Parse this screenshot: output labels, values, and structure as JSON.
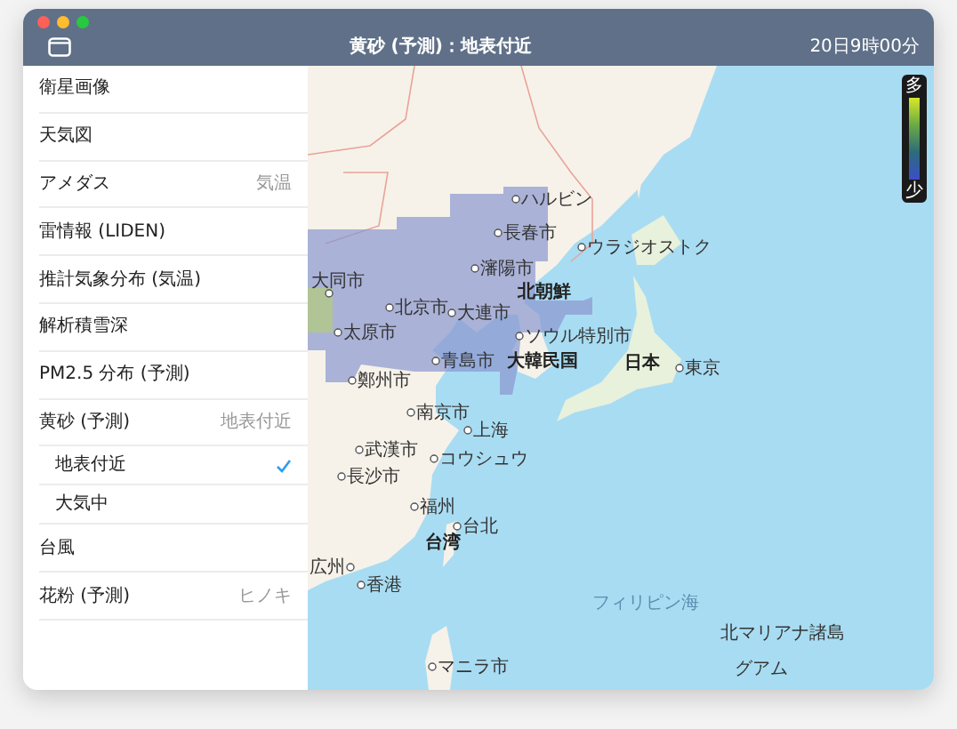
{
  "window": {
    "title": "黄砂 (予測)：地表付近",
    "time": "20日9時00分"
  },
  "sidebar": {
    "items": [
      {
        "label": "衛星画像"
      },
      {
        "label": "天気図"
      },
      {
        "label": "アメダス",
        "value": "気温"
      },
      {
        "label": "雷情報 (LIDEN)"
      },
      {
        "label": "推計気象分布 (気温)"
      },
      {
        "label": "解析積雪深"
      },
      {
        "label": "PM2.5 分布 (予測)"
      },
      {
        "label": "黄砂 (予測)",
        "value": "地表付近",
        "children": [
          {
            "label": "地表付近",
            "selected": true
          },
          {
            "label": "大気中",
            "selected": false
          }
        ]
      },
      {
        "label": "台風"
      },
      {
        "label": "花粉 (予測)",
        "value": "ヒノキ"
      }
    ]
  },
  "map": {
    "labels": [
      {
        "text": "ハルビン",
        "kind": "city"
      },
      {
        "text": "長春市",
        "kind": "city"
      },
      {
        "text": "瀋陽市",
        "kind": "city"
      },
      {
        "text": "ウラジオストク",
        "kind": "city"
      },
      {
        "text": "大同市",
        "kind": "city"
      },
      {
        "text": "北京市",
        "kind": "city"
      },
      {
        "text": "大連市",
        "kind": "city"
      },
      {
        "text": "北朝鮮",
        "kind": "country"
      },
      {
        "text": "太原市",
        "kind": "city"
      },
      {
        "text": "ソウル特別市",
        "kind": "city"
      },
      {
        "text": "青島市",
        "kind": "city"
      },
      {
        "text": "大韓民国",
        "kind": "country"
      },
      {
        "text": "鄭州市",
        "kind": "city"
      },
      {
        "text": "日本",
        "kind": "country"
      },
      {
        "text": "東京",
        "kind": "city"
      },
      {
        "text": "南京市",
        "kind": "city"
      },
      {
        "text": "上海",
        "kind": "city"
      },
      {
        "text": "武漢市",
        "kind": "city"
      },
      {
        "text": "コウシュウ",
        "kind": "city"
      },
      {
        "text": "長沙市",
        "kind": "city"
      },
      {
        "text": "福州",
        "kind": "city"
      },
      {
        "text": "台北",
        "kind": "city"
      },
      {
        "text": "台湾",
        "kind": "country"
      },
      {
        "text": "広州",
        "kind": "city"
      },
      {
        "text": "香港",
        "kind": "city"
      },
      {
        "text": "フィリピン海",
        "kind": "sea"
      },
      {
        "text": "マニラ市",
        "kind": "city"
      },
      {
        "text": "北マリアナ諸島",
        "kind": "region"
      },
      {
        "text": "グアム",
        "kind": "region"
      }
    ],
    "legend": {
      "top": "多",
      "bottom": "少"
    }
  }
}
